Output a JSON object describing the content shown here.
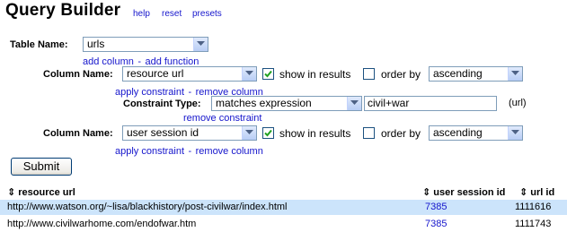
{
  "header": {
    "title": "Query Builder",
    "links": {
      "help": "help",
      "reset": "reset",
      "presets": "presets"
    }
  },
  "table": {
    "label": "Table Name:",
    "value": "urls",
    "add_column": "add column",
    "separator": "-",
    "add_function": "add function"
  },
  "column1": {
    "label": "Column Name:",
    "value": "resource url",
    "show_checked": true,
    "show_label": "show in results",
    "order_checked": false,
    "order_label": "order by",
    "order_value": "ascending",
    "apply_constraint": "apply constraint",
    "separator": "-",
    "remove_column": "remove column"
  },
  "constraint": {
    "label": "Constraint Type:",
    "value": "matches expression",
    "text_value": "civil+war",
    "unit": "(url)",
    "remove_constraint": "remove constraint"
  },
  "column2": {
    "label": "Column Name:",
    "value": "user session id",
    "show_checked": true,
    "show_label": "show in results",
    "order_checked": false,
    "order_label": "order by",
    "order_value": "ascending",
    "apply_constraint": "apply constraint",
    "separator": "-",
    "remove_column": "remove column"
  },
  "submit_label": "Submit",
  "results": {
    "sort_glyph": "⇕",
    "columns": [
      "resource url",
      "user session id",
      "url id"
    ],
    "rows": [
      {
        "url": "http://www.watson.org/~lisa/blackhistory/post-civilwar/index.html",
        "session": "7385",
        "id": "1111616"
      },
      {
        "url": "http://www.civilwarhome.com/endofwar.htm",
        "session": "7385",
        "id": "1111743"
      }
    ],
    "highlight_color": "#cce4fb",
    "link_color": "#1515cc"
  },
  "icons": {
    "dropdown": "chevron-down-icon",
    "checkbox": "checkmark-icon",
    "sort": "sort-icon"
  }
}
